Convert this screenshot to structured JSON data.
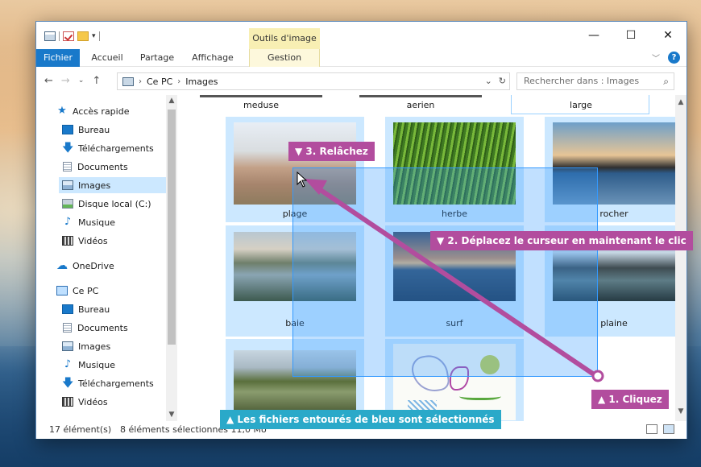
{
  "window": {
    "contextual_tab": "Outils d'image",
    "ribbon_tabs": [
      "Fichier",
      "Accueil",
      "Partage",
      "Affichage",
      "Gestion"
    ],
    "controls": {
      "minimize": "—",
      "maximize": "☐",
      "close": "✕"
    }
  },
  "address": {
    "path": [
      "Ce PC",
      "Images"
    ],
    "search_placeholder": "Rechercher dans : Images"
  },
  "sidebar": {
    "items": [
      {
        "label": "Accès rapide",
        "icon": "star-icon"
      },
      {
        "label": "Bureau",
        "icon": "desktop-icon",
        "pinned": true
      },
      {
        "label": "Téléchargements",
        "icon": "download-icon",
        "pinned": true
      },
      {
        "label": "Documents",
        "icon": "document-icon",
        "pinned": true
      },
      {
        "label": "Images",
        "icon": "pictures-icon",
        "pinned": true,
        "selected": true
      },
      {
        "label": "Disque local (C:)",
        "icon": "drive-icon",
        "pinned": true
      },
      {
        "label": "Musique",
        "icon": "music-icon"
      },
      {
        "label": "Vidéos",
        "icon": "video-icon"
      },
      {
        "label": "OneDrive",
        "icon": "cloud-icon"
      },
      {
        "label": "Ce PC",
        "icon": "computer-icon"
      },
      {
        "label": "Bureau",
        "icon": "desktop-icon"
      },
      {
        "label": "Documents",
        "icon": "document-icon"
      },
      {
        "label": "Images",
        "icon": "pictures-icon"
      },
      {
        "label": "Musique",
        "icon": "music-icon"
      },
      {
        "label": "Téléchargements",
        "icon": "download-icon"
      },
      {
        "label": "Vidéos",
        "icon": "video-icon"
      }
    ]
  },
  "files": {
    "top_labels": [
      "meduse",
      "aerien",
      "large"
    ],
    "items": [
      {
        "name": "plage",
        "selected": true
      },
      {
        "name": "herbe",
        "selected": true
      },
      {
        "name": "rocher",
        "selected": true
      },
      {
        "name": "baie",
        "selected": true
      },
      {
        "name": "surf",
        "selected": true
      },
      {
        "name": "plaine",
        "selected": true
      },
      {
        "name": "",
        "selected": true
      },
      {
        "name": "",
        "selected": true
      }
    ]
  },
  "status": {
    "count": "17 élément(s)",
    "selected": "8 éléments sélectionnés 11,0 Mo"
  },
  "tutorial": {
    "step1": "1. Cliquez",
    "step2": "2. Déplacez le curseur en maintenant le clic",
    "step3": "3. Relâchez",
    "note": "Les fichiers entourés de bleu sont sélectionnés",
    "colors": {
      "callout": "#b24d9e",
      "note": "#2aa9c9",
      "marquee": "#3399ff",
      "accent": "#1979ca"
    }
  }
}
